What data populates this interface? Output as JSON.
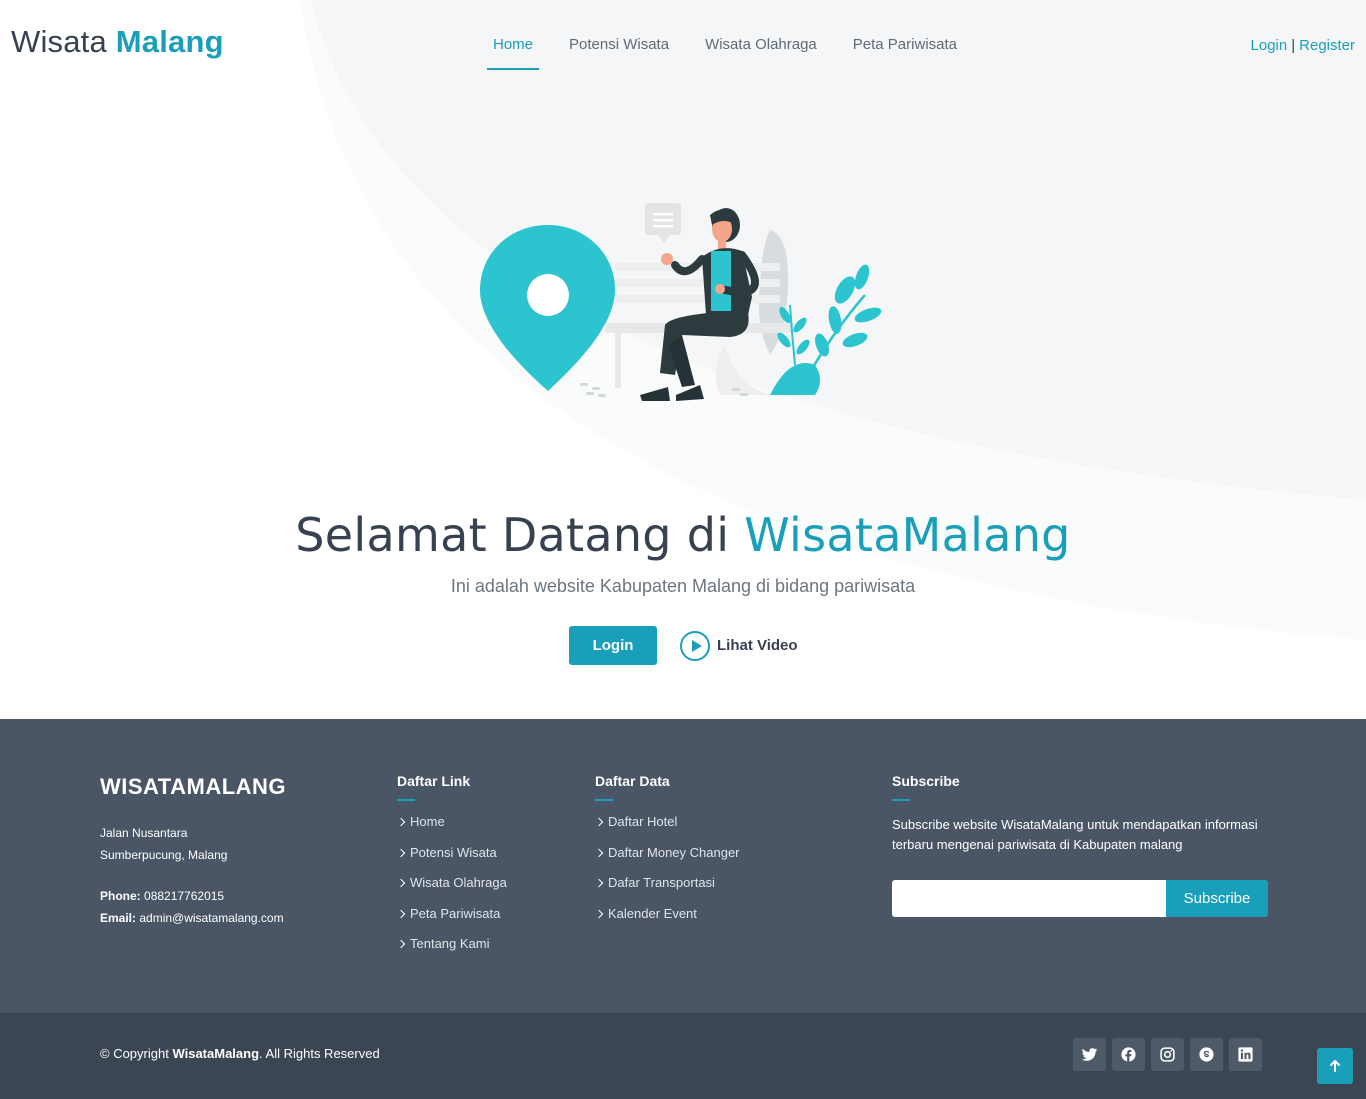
{
  "header": {
    "logo_main": "Wisata",
    "logo_accent": "Malang",
    "nav": [
      {
        "label": "Home",
        "active": true
      },
      {
        "label": "Potensi Wisata",
        "active": false
      },
      {
        "label": "Wisata Olahraga",
        "active": false
      },
      {
        "label": "Peta Pariwisata",
        "active": false
      }
    ],
    "login_label": "Login",
    "separator": "|",
    "register_label": "Register"
  },
  "hero": {
    "title_main": "Selamat Datang di",
    "title_accent": "WisataMalang",
    "subtitle": "Ini adalah website Kabupaten Malang di bidang pariwisata",
    "login_button": "Login",
    "video_label": "Lihat Video"
  },
  "footer": {
    "brand": "WISATAMALANG",
    "address_line1": "Jalan Nusantara",
    "address_line2": "Sumberpucung, Malang",
    "phone_label": "Phone:",
    "phone_value": "088217762015",
    "email_label": "Email:",
    "email_value": "admin@wisatamalang.com",
    "links_title": "Daftar Link",
    "links": [
      "Home",
      "Potensi Wisata",
      "Wisata Olahraga",
      "Peta Pariwisata",
      "Tentang Kami"
    ],
    "data_title": "Daftar Data",
    "data_links": [
      "Daftar Hotel",
      "Daftar Money Changer",
      "Dafar Transportasi",
      "Kalender Event"
    ],
    "subscribe_title": "Subscribe",
    "subscribe_text": "Subscribe website WisataMalang untuk mendapatkan informasi terbaru mengenai pariwisata di Kabupaten malang",
    "subscribe_placeholder": "",
    "subscribe_button": "Subscribe"
  },
  "bottom": {
    "copyright_prefix": "© Copyright",
    "copyright_brand": "WisataMalang",
    "copyright_suffix": ". All Rights Reserved",
    "socials": [
      "twitter-icon",
      "facebook-icon",
      "instagram-icon",
      "skype-icon",
      "linkedin-icon"
    ]
  },
  "colors": {
    "accent": "#1a9fbb",
    "text_dark": "#37414f",
    "footer_bg": "#4a5665",
    "footer_bottom_bg": "#3b4653"
  }
}
